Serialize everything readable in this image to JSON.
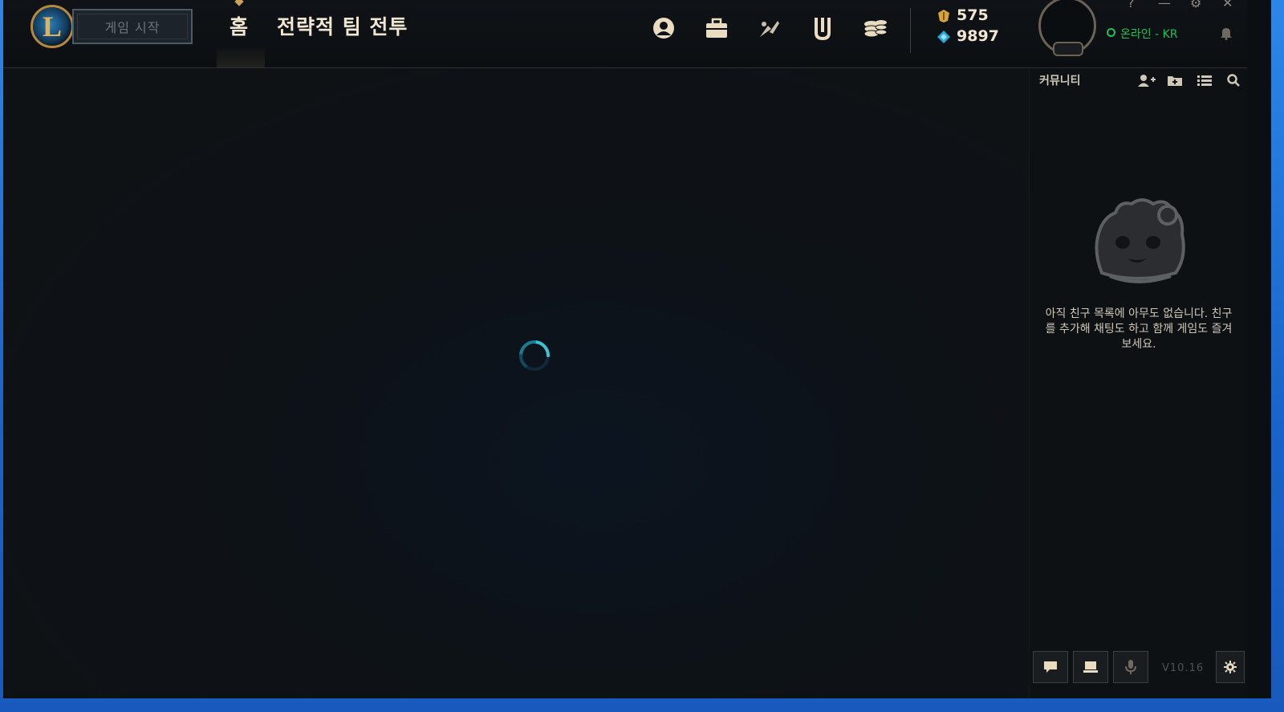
{
  "window": {
    "controls": [
      "?",
      "—",
      "⚙",
      "✕"
    ]
  },
  "header": {
    "play_label": "게임 시작",
    "tabs": [
      {
        "label": "홈",
        "active": true
      },
      {
        "label": "전략적 팀 전투",
        "active": false
      }
    ],
    "icons": [
      "profile-icon",
      "collection-icon",
      "loot-icon",
      "clash-icon",
      "store-icon"
    ],
    "wallet": {
      "blue_essence": "575",
      "riot_points": "9897"
    },
    "status": "온라인 - KR"
  },
  "main": {
    "state": "loading"
  },
  "sidebar": {
    "title": "커뮤니티",
    "icons": [
      "add-friend-icon",
      "add-folder-icon",
      "list-icon",
      "search-icon"
    ],
    "empty_message": "아직 친구 목록에 아무도 없습니다. 친구를 추가해 채팅도 하고 함께 게임도 즐겨 보세요.",
    "version": "V10.16"
  },
  "colors": {
    "accent_gold": "#c8aa6e",
    "status_green": "#1fbf5b",
    "spinner_teal": "#1fa3b8"
  }
}
